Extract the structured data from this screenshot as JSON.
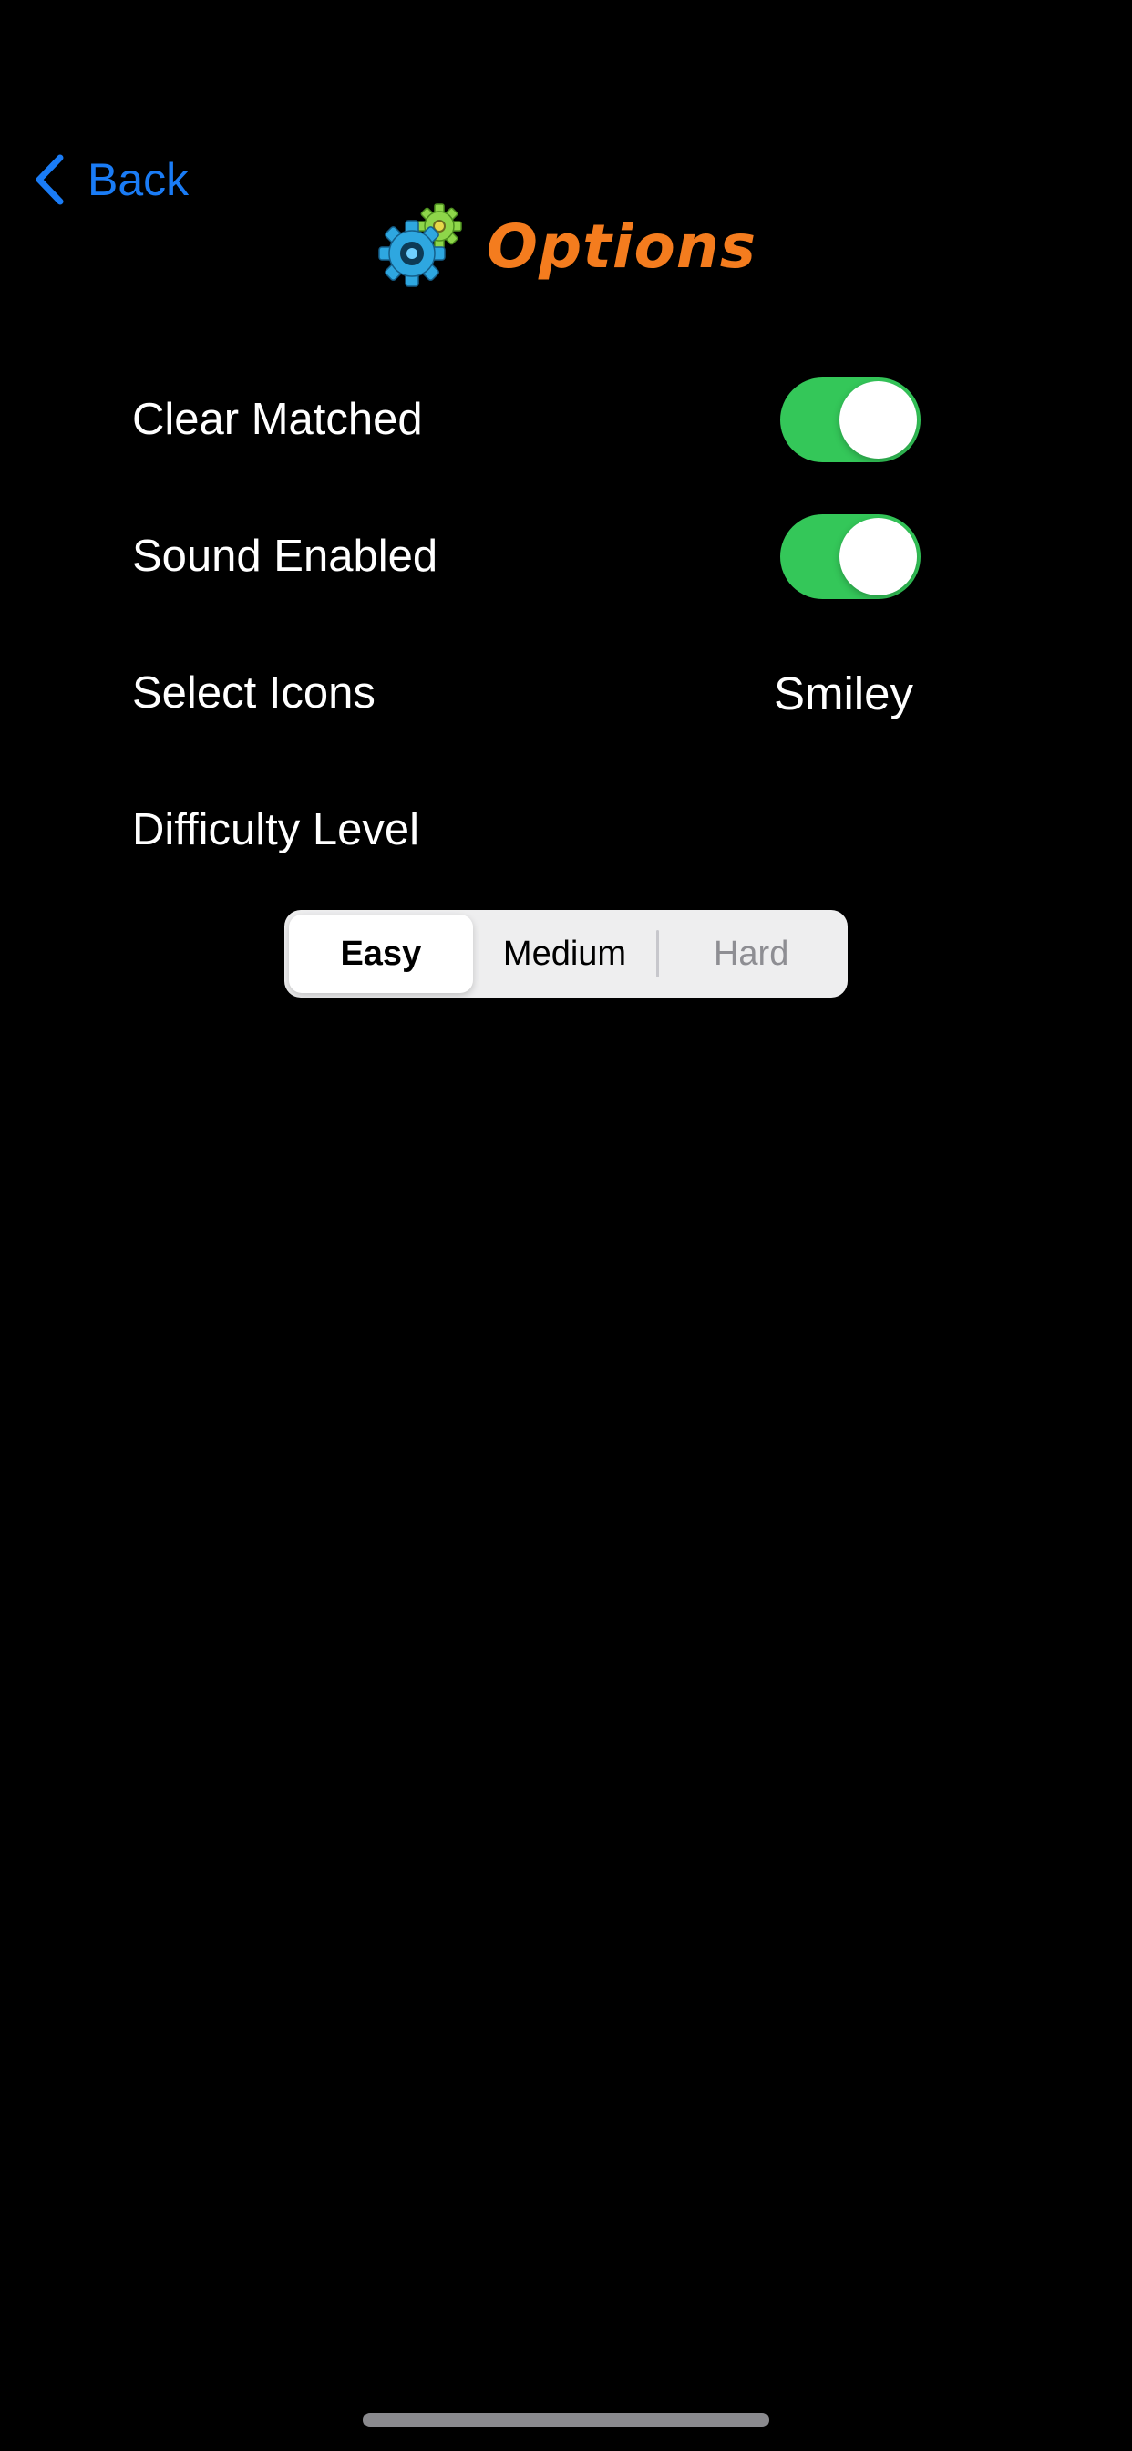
{
  "nav": {
    "back_label": "Back"
  },
  "header": {
    "title": "Options",
    "icon": "gears-icon"
  },
  "settings": {
    "clear_matched": {
      "label": "Clear Matched",
      "enabled": true
    },
    "sound_enabled": {
      "label": "Sound Enabled",
      "enabled": true
    },
    "select_icons": {
      "label": "Select Icons",
      "value": "Smiley"
    },
    "difficulty": {
      "label": "Difficulty Level",
      "options": [
        "Easy",
        "Medium",
        "Hard"
      ],
      "selected": "Easy",
      "disabled": [
        "Hard"
      ]
    }
  },
  "colors": {
    "background": "#000000",
    "accent_blue": "#1a7cf6",
    "title_orange": "#f47c1e",
    "toggle_on": "#34c759",
    "segment_bg": "#eeeeef",
    "disabled_text": "#8e8e93"
  }
}
